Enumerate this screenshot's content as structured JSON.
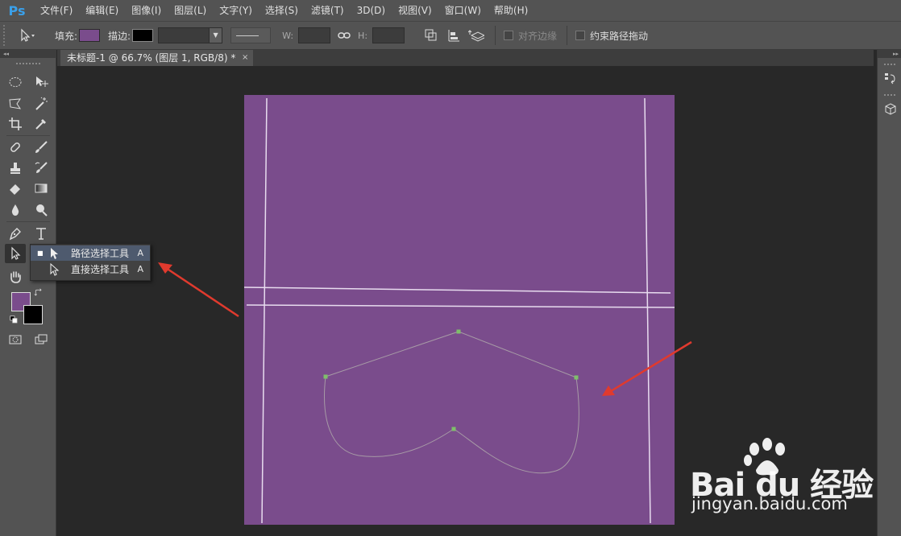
{
  "app": {
    "logo": "Ps"
  },
  "menu": [
    "文件(F)",
    "编辑(E)",
    "图像(I)",
    "图层(L)",
    "文字(Y)",
    "选择(S)",
    "滤镜(T)",
    "3D(D)",
    "视图(V)",
    "窗口(W)",
    "帮助(H)"
  ],
  "options": {
    "fill_label": "填充:",
    "stroke_label": "描边:",
    "fill_color": "#7a4c8c",
    "stroke_color": "#000000",
    "w_label": "W:",
    "h_label": "H:",
    "w_value": "",
    "h_value": "",
    "align_edges_label": "对齐边缘",
    "constrain_path_label": "约束路径拖动"
  },
  "document": {
    "tab_title": "未标题-1 @ 66.7% (图层 1, RGB/8) *",
    "close_glyph": "×",
    "background_color": "#7a4c8c"
  },
  "flyout": {
    "items": [
      {
        "label": "路径选择工具",
        "shortcut": "A",
        "selected": true
      },
      {
        "label": "直接选择工具",
        "shortcut": "A",
        "selected": false
      }
    ],
    "bullet": "■"
  },
  "colors": {
    "foreground": "#7a4c8c",
    "background": "#000000",
    "annotation_arrow": "#e03a2e"
  },
  "watermark": {
    "brand": "Bai du 经验",
    "url": "jingyan.baidu.com"
  }
}
